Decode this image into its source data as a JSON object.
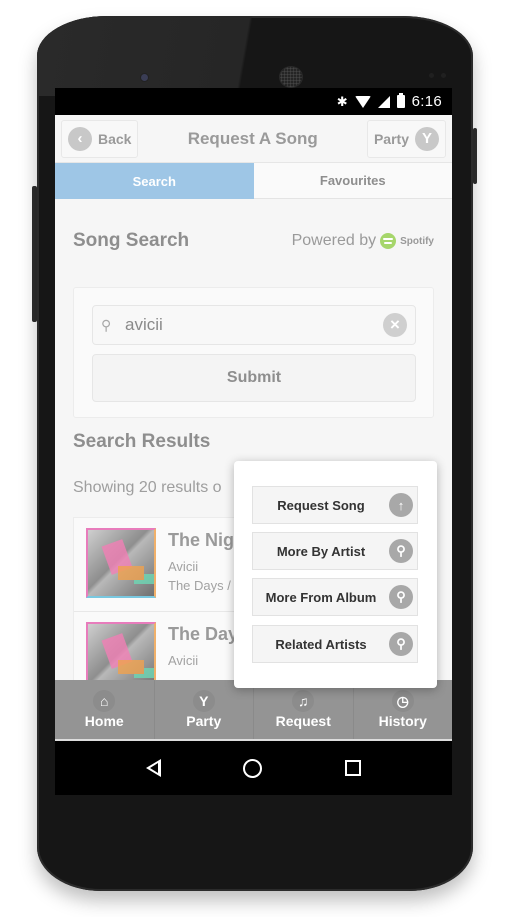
{
  "status_bar": {
    "icons": [
      "bluetooth-icon",
      "wifi-icon",
      "cell-signal-icon",
      "battery-icon"
    ],
    "time": "6:16"
  },
  "header": {
    "back_label": "Back",
    "title": "Request A Song",
    "party_label": "Party"
  },
  "tabs": [
    {
      "label": "Search",
      "active": true
    },
    {
      "label": "Favourites",
      "active": false
    }
  ],
  "song_search": {
    "heading": "Song Search",
    "powered_by": "Powered by",
    "provider": "Spotify",
    "query": "avicii",
    "submit_label": "Submit"
  },
  "results": {
    "heading": "Search Results",
    "summary": "Showing 20 results o",
    "items": [
      {
        "title": "The Nigh",
        "artist": "Avicii",
        "album": "The Days /"
      },
      {
        "title": "The Days",
        "artist": "Avicii",
        "album": ""
      }
    ]
  },
  "popup_menu": {
    "items": [
      {
        "label": "Request Song",
        "icon": "arrow-up-icon"
      },
      {
        "label": "More By Artist",
        "icon": "search-icon"
      },
      {
        "label": "More From Album",
        "icon": "search-icon"
      },
      {
        "label": "Related Artists",
        "icon": "search-icon"
      }
    ]
  },
  "tab_bar": {
    "items": [
      {
        "label": "Home",
        "icon": "home-icon"
      },
      {
        "label": "Party",
        "icon": "cocktail-icon"
      },
      {
        "label": "Request",
        "icon": "music-note-icon"
      },
      {
        "label": "History",
        "icon": "clock-icon"
      }
    ]
  },
  "colors": {
    "active_tab": "#9ec6e6",
    "spotify_green": "#a6d66b",
    "tab_bar": "#949494"
  }
}
